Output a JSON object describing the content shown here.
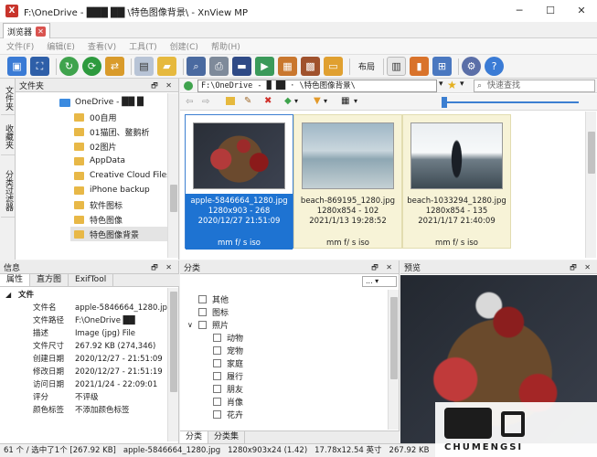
{
  "window": {
    "title": "F:\\OneDrive - ███  ██ \\特色图像背景\\ - XnView MP",
    "controls": [
      "─",
      "☐",
      "✕"
    ]
  },
  "tabs": [
    {
      "label": "浏览器"
    }
  ],
  "menu": [
    "文件(F)",
    "编辑(E)",
    "查看(V)",
    "工具(T)",
    "创建(C)",
    "帮助(H)"
  ],
  "toolbar": {
    "layout_label": "布局"
  },
  "side_tabs": [
    "文件夹",
    "收藏夹",
    "分类过滤器"
  ],
  "folders_panel": {
    "title": "文件夹",
    "items": [
      {
        "label": "OneDrive - ██ █",
        "type": "drive"
      },
      {
        "label": "00自用",
        "type": "folder"
      },
      {
        "label": "01猫团、鳌鹅析",
        "type": "folder"
      },
      {
        "label": "02图片",
        "type": "folder"
      },
      {
        "label": "AppData",
        "type": "folder"
      },
      {
        "label": "Creative Cloud Files",
        "type": "folder"
      },
      {
        "label": "iPhone backup",
        "type": "folder"
      },
      {
        "label": "软件图标",
        "type": "folder"
      },
      {
        "label": "特色图像",
        "type": "folder"
      },
      {
        "label": "特色图像背景",
        "type": "folder"
      }
    ]
  },
  "browser": {
    "address": "F:\\OneDrive - █  ██ ·  \\特色图像背景\\",
    "search_placeholder": "快速查找",
    "thumbnails": [
      {
        "name": "apple-5846664_1280.jpg",
        "dims": "1280x903 - 268",
        "date": "2020/12/27 21:51:09",
        "exif": "mm f/ s iso",
        "selected": true
      },
      {
        "name": "beach-869195_1280.jpg",
        "dims": "1280x854 - 102",
        "date": "2021/1/13 19:28:52",
        "exif": "mm f/ s iso",
        "selected": false
      },
      {
        "name": "beach-1033294_1280.jpg",
        "dims": "1280x854 - 135",
        "date": "2021/1/17 21:40:09",
        "exif": "mm f/ s iso",
        "selected": false
      }
    ]
  },
  "info_panel": {
    "title": "信息",
    "tabs": [
      "属性",
      "直方图",
      "ExifTool"
    ],
    "section": "文件",
    "rows": [
      {
        "key": "文件名",
        "value": "apple-5846664_1280.jpg"
      },
      {
        "key": "文件路径",
        "value": "F:\\OneDrive ██"
      },
      {
        "key": "描述",
        "value": "Image (jpg) File"
      },
      {
        "key": "文件尺寸",
        "value": "267.92 KB (274,346)"
      },
      {
        "key": "创建日期",
        "value": "2020/12/27 - 21:51:09"
      },
      {
        "key": "修改日期",
        "value": "2020/12/27 - 21:51:19"
      },
      {
        "key": "访问日期",
        "value": "2021/1/24 - 22:09:01"
      },
      {
        "key": "评分",
        "value": "不评级"
      },
      {
        "key": "颜色标签",
        "value": "不添加颜色标签"
      }
    ]
  },
  "category_panel": {
    "title": "分类",
    "dropdown": "...",
    "items": [
      {
        "label": "其他",
        "level": 0
      },
      {
        "label": "图标",
        "level": 0
      },
      {
        "label": "照片",
        "level": 0,
        "expanded": true
      },
      {
        "label": "动物",
        "level": 1
      },
      {
        "label": "宠物",
        "level": 1
      },
      {
        "label": "家庭",
        "level": 1
      },
      {
        "label": "履行",
        "level": 1
      },
      {
        "label": "朋友",
        "level": 1
      },
      {
        "label": "肖像",
        "level": 1
      },
      {
        "label": "花卉",
        "level": 1
      }
    ],
    "tabs": [
      "分类",
      "分类集"
    ]
  },
  "preview_panel": {
    "title": "预览"
  },
  "statusbar": {
    "count": "61 个 / 选中了1个 [267.92 KB]",
    "filename": "apple-5846664_1280.jpg",
    "dims": "1280x903x24 (1.42)",
    "size_in": "17.78x12.54 英寸",
    "filesize": "267.92 KB"
  },
  "watermark": {
    "text": "CHUMENGSI"
  },
  "colors": {
    "selection": "#1e73d2",
    "card_bg": "#f7f3d7",
    "accent": "#c8342b"
  }
}
